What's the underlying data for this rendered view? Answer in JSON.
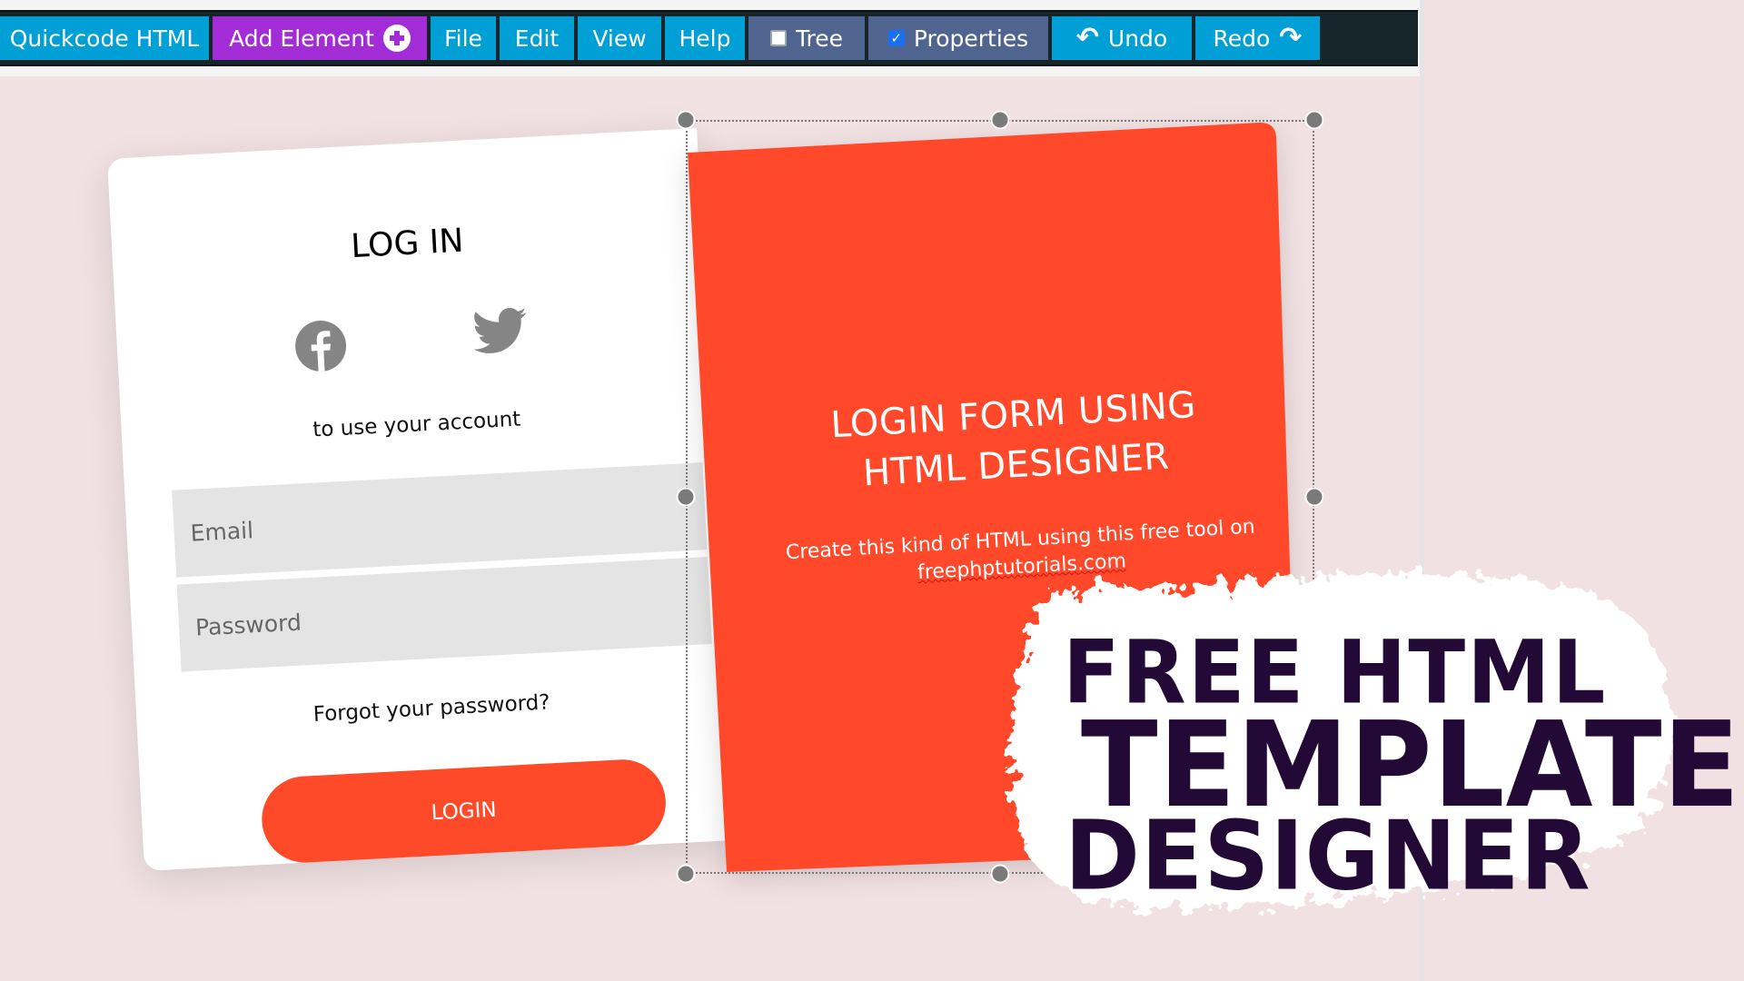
{
  "toolbar": {
    "brand": "Quickcode HTML",
    "add_element": "Add Element",
    "file": "File",
    "edit": "Edit",
    "view": "View",
    "help": "Help",
    "tree": "Tree",
    "tree_checked": false,
    "properties": "Properties",
    "properties_checked": true,
    "undo": "Undo",
    "redo": "Redo"
  },
  "login_card": {
    "title": "LOG IN",
    "social": [
      "facebook-icon",
      "twitter-icon"
    ],
    "subtitle": "to use your account",
    "email_placeholder": "Email",
    "password_placeholder": "Password",
    "forgot": "Forgot your password?",
    "login_button": "LOGIN"
  },
  "red_panel": {
    "title_line1": "LOGIN FORM USING",
    "title_line2": "HTML DESIGNER",
    "desc_line1": "Create this kind of HTML using this free tool on",
    "desc_link": "freephptutorials.com"
  },
  "promo": {
    "line1": "FREE HTML",
    "line2": "TEMPLATE",
    "line3": "DESIGNER"
  },
  "colors": {
    "toolbar_bg": "#16252a",
    "button_blue": "#009fd6",
    "button_purple": "#a22cd6",
    "button_slate": "#4f6590",
    "accent_red": "#ff4a2a",
    "canvas_bg": "#f1e1e3",
    "promo_text": "#230a36"
  }
}
